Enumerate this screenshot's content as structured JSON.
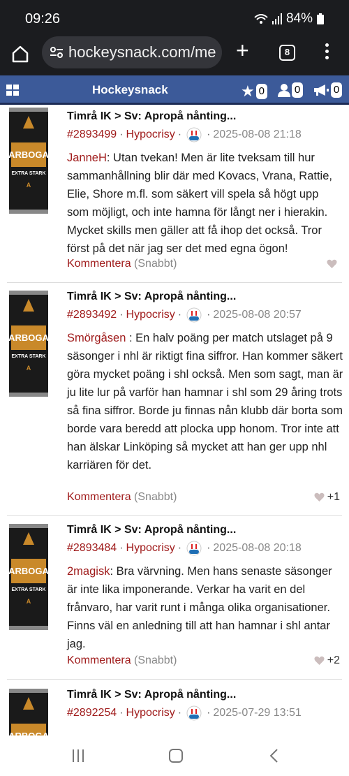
{
  "status": {
    "time": "09:26",
    "battery": "84%"
  },
  "browser": {
    "url": "hockeysnack.com/me",
    "tab_count": "8"
  },
  "app": {
    "title": "Hockeysnack",
    "star_count": "0",
    "user_count": "0",
    "announce_count": "0"
  },
  "posts": [
    {
      "title": "Timrå IK > Sv: Apropå nånting...",
      "id": "#2893499",
      "user": "Hypocrisy",
      "date": "2025-08-08 21:18",
      "author": "JanneH",
      "text": ": Utan tvekan! Men är lite tveksam till hur sammanhållning blir där med Kovacs, Vrana, Rattie, Elie, Shore m.fl. som säkert vill spela så högt upp som möjligt, och inte hamna för långt ner i hierakin. Mycket skills men gäller att få ihop det också. Tror först på det när jag ser det med egna ögon!",
      "comment": "Kommentera",
      "quick": "(Snabbt)",
      "likes": ""
    },
    {
      "title": "Timrå IK > Sv: Apropå nånting...",
      "id": "#2893492",
      "user": "Hypocrisy",
      "date": "2025-08-08 20:57",
      "author": "Smörgåsen",
      "text": " : En halv poäng per match utslaget på 9 säsonger i nhl är riktigt fina siffror. Han kommer säkert göra mycket poäng i shl också. Men som sagt, man är ju lite lur på varför han hamnar i shl som 29 åring trots så fina siffror. Borde ju finnas nån klubb där borta som borde vara beredd att plocka upp honom. Tror inte att han älskar Linköping så mycket att han ger upp nhl karriären för det.",
      "comment": "Kommentera",
      "quick": "(Snabbt)",
      "likes": "+1"
    },
    {
      "title": "Timrå IK > Sv: Apropå nånting...",
      "id": "#2893484",
      "user": "Hypocrisy",
      "date": "2025-08-08 20:18",
      "author": "2magisk",
      "text": ": Bra värvning. Men hans senaste säsonger är inte lika imponerande. Verkar ha varit en del frånvaro, har varit runt i många olika organisationer. Finns väl en anledning till att han hamnar i shl antar jag.",
      "comment": "Kommentera",
      "quick": "(Snabbt)",
      "likes": "+2"
    },
    {
      "title": "Timrå IK > Sv: Apropå nånting...",
      "id": "#2892254",
      "user": "Hypocrisy",
      "date": "2025-07-29 13:51"
    }
  ],
  "can_label": {
    "brand": "ARBOGA",
    "sub": "EXTRA STARK",
    "grade": "A"
  },
  "colors": {
    "appbar": "#3c5a99",
    "link": "#a01c1c",
    "dark": "#1b1c1f"
  }
}
